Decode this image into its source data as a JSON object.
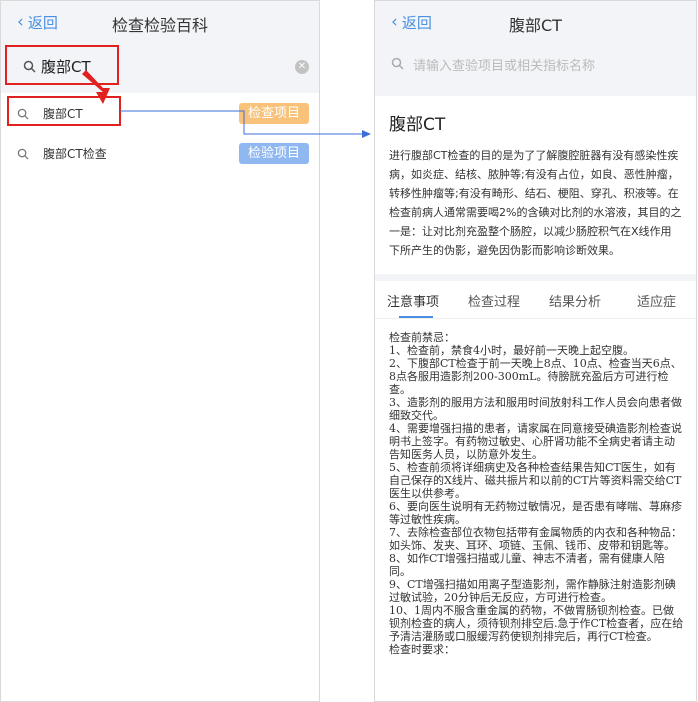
{
  "left": {
    "back_label": "返回",
    "title": "检查检验百科",
    "search_value": "腹部CT",
    "clear_icon": "clear-icon",
    "results": [
      {
        "label": "腹部CT",
        "tag": "检查项目",
        "tag_color": "#f8c27a"
      },
      {
        "label": "腹部CT检查",
        "tag": "检验项目",
        "tag_color": "#8fb8f0"
      }
    ]
  },
  "right": {
    "back_label": "返回",
    "title": "腹部CT",
    "search_placeholder": "请输入查验项目或相关指标名称",
    "detail_title": "腹部CT",
    "description": "进行腹部CT检查的目的是为了了解腹腔脏器有没有感染性疾病，如炎症、结核、脓肿等;有没有占位，如良、恶性肿瘤，转移性肿瘤等;有没有畸形、结石、梗阻、穿孔、积液等。在检查前病人通常需要喝2%的含碘对比剂的水溶液，其目的之一是：让对比剂充盈整个肠腔，以减少肠腔积气在X线作用下所产生的伪影，避免因伪影而影响诊断效果。",
    "tabs": [
      "注意事项",
      "检查过程",
      "结果分析",
      "适应症"
    ],
    "active_tab": 0,
    "notes": [
      "检查前禁忌：",
      "1、检查前，禁食4小时，最好前一天晚上起空腹。",
      "2、下腹部CT检查于前一天晚上8点、10点、检查当天6点、8点各服用造影剂200-300mL。待膀胱充盈后方可进行检查。",
      "3、造影剂的服用方法和服用时间放射科工作人员会向患者做细致交代。",
      "4、需要增强扫描的患者，请家属在同意接受碘造影剂检查说明书上签字。有药物过敏史、心肝肾功能不全病史者请主动告知医务人员，以防意外发生。",
      "5、检查前须将详细病史及各种检查结果告知CT医生，如有自己保存的X线片、磁共振片和以前的CT片等资料需交给CT医生以供参考。",
      "6、要向医生说明有无药物过敏情况，是否患有哮喘、荨麻疹等过敏性疾病。",
      "7、去除检查部位衣物包括带有金属物质的内衣和各种物品：如头饰、发夹、耳环、项链、玉佩、钱币、皮带和钥匙等。",
      "8、如作CT增强扫描或儿童、神志不清者，需有健康人陪同。",
      "9、CT增强扫描如用离子型造影剂，需作静脉注射造影剂碘过敏试验，20分钟后无反应，方可进行检查。",
      "10、1周内不服含重金属的药物，不做胃肠钡剂检查。已做钡剂检查的病人，须待钡剂排空后.急于作CT检查者，应在给予清洁灌肠或口服缓泻药使钡剂排完后，再行CT检查。",
      "检查时要求："
    ]
  },
  "colors": {
    "accent": "#4a90e2",
    "highlight": "#e12020",
    "tag_orange": "#f8c27a",
    "tag_blue": "#8fb8f0"
  }
}
